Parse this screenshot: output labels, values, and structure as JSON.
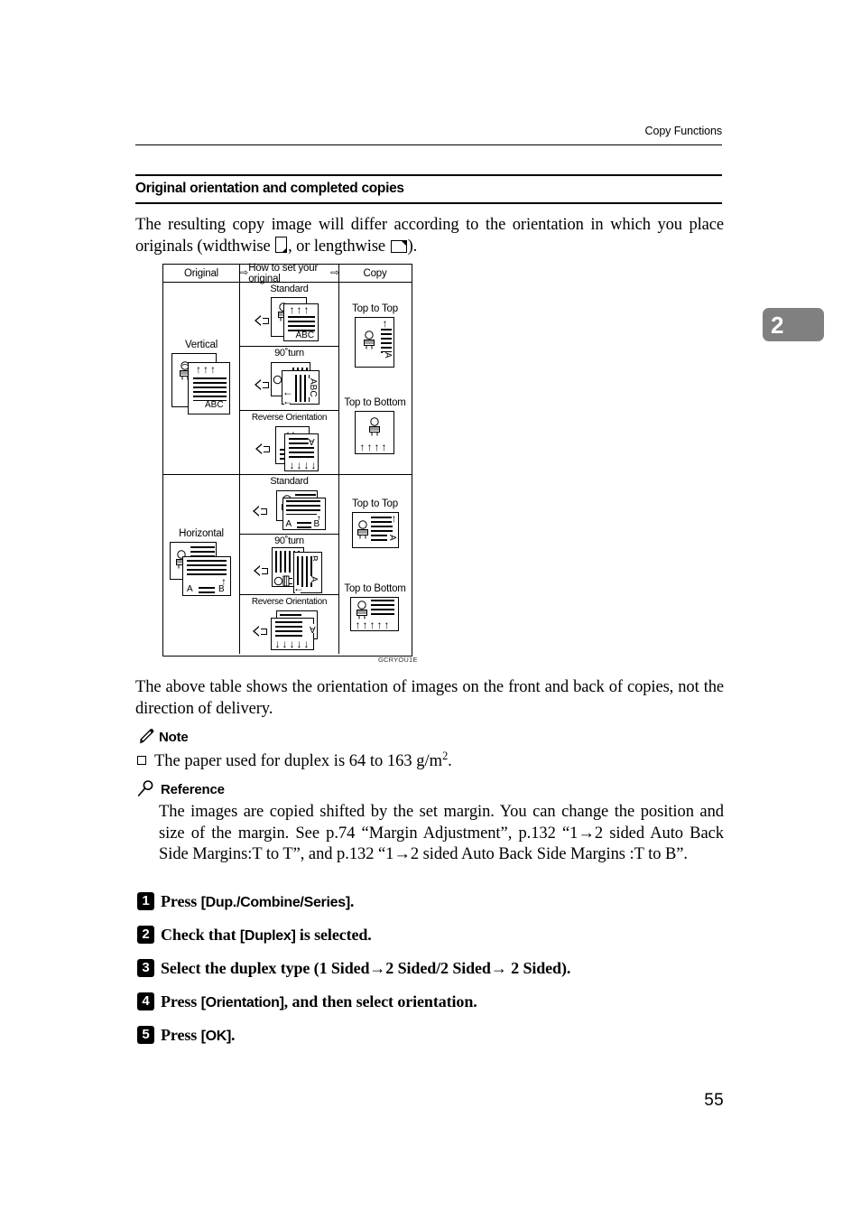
{
  "document": {
    "running_head": "Copy Functions",
    "page_number": "55",
    "chapter_tab": "2",
    "chapter_tab_color": "#808080"
  },
  "section": {
    "title": "Original orientation and completed copies",
    "intro_before": "The resulting copy image will differ according to the orientation in which you place originals (widthwise ",
    "intro_middle": ", or lengthwise ",
    "intro_after": ").",
    "icon_widthwise": "widthwise-orientation-icon",
    "icon_lengthwise": "lengthwise-orientation-icon"
  },
  "figure": {
    "id_label": "GCRYOU1E",
    "headers": {
      "original": "Original",
      "how_to_set": "How to set your original",
      "copy": "Copy",
      "arrow_glyph": "⇨"
    },
    "rows": [
      {
        "original_label": "Vertical",
        "original_text_marks": [
          "ABC"
        ],
        "methods": [
          {
            "label": "Standard",
            "doc_marks": [
              "ABC"
            ]
          },
          {
            "label": "90˚turn",
            "doc_marks": [
              "ABC"
            ]
          },
          {
            "label": "Reverse Orientation",
            "doc_marks": [
              "A"
            ]
          }
        ],
        "copies": [
          {
            "label": "Top to Top",
            "mark": "A"
          },
          {
            "label": "Top to Bottom",
            "mark": ""
          }
        ]
      },
      {
        "original_label": "Horizontal",
        "original_text_marks": [
          "A",
          "B"
        ],
        "methods": [
          {
            "label": "Standard",
            "doc_marks": [
              "A",
              "B"
            ]
          },
          {
            "label": "90˚turn",
            "doc_marks": [
              "A",
              "B"
            ]
          },
          {
            "label": "Reverse Orientation",
            "doc_marks": [
              "A"
            ]
          }
        ],
        "copies": [
          {
            "label": "Top to Top",
            "mark": "A"
          },
          {
            "label": "Top to Bottom",
            "mark": ""
          }
        ]
      }
    ]
  },
  "below_figure": {
    "paragraph": "The above table shows the orientation of images on the front and back of copies, not the direction of delivery."
  },
  "note": {
    "title": "Note",
    "icon": "pencil-icon",
    "item_before": "The paper used for duplex is 64 to 163 g/m",
    "item_sup": "2",
    "item_after": "."
  },
  "reference": {
    "title": "Reference",
    "icon": "magnifier-icon",
    "body": "The images are copied shifted by the set margin. You can change the position and size of the margin. See p.74 “Margin Adjustment”, p.132 “1→2 sided Auto Back Side Margins:T to T”, and p.132 “1→2 sided Auto Back Side Margins :T to B”."
  },
  "steps": [
    {
      "num": "1",
      "before": "Press ",
      "ui": "[Dup./Combine/Series]",
      "after": "."
    },
    {
      "num": "2",
      "before": "Check that ",
      "ui": "[Duplex]",
      "after": " is selected."
    },
    {
      "num": "3",
      "before": "Select the duplex type (1 Sided→2 Sided/2 Sided→ 2 Sided).",
      "ui": "",
      "after": ""
    },
    {
      "num": "4",
      "before": "Press ",
      "ui": "[Orientation]",
      "after": ", and then select orientation."
    },
    {
      "num": "5",
      "before": "Press ",
      "ui": "[OK]",
      "after": "."
    }
  ]
}
